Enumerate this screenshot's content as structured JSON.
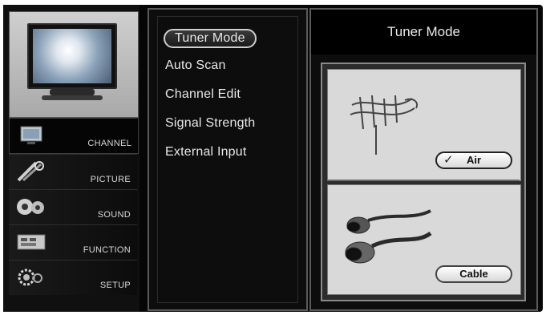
{
  "categories": [
    {
      "label": "CHANNEL",
      "icon": "channel-icon",
      "active": true
    },
    {
      "label": "PICTURE",
      "icon": "picture-icon",
      "active": false
    },
    {
      "label": "SOUND",
      "icon": "sound-icon",
      "active": false
    },
    {
      "label": "FUNCTION",
      "icon": "function-icon",
      "active": false
    },
    {
      "label": "SETUP",
      "icon": "setup-icon",
      "active": false
    }
  ],
  "menu": {
    "items": [
      "Tuner Mode",
      "Auto Scan",
      "Channel Edit",
      "Signal Strength",
      "External Input"
    ],
    "selected": "Tuner Mode"
  },
  "panel": {
    "title": "Tuner Mode",
    "options": [
      {
        "label": "Air",
        "icon": "antenna-icon",
        "selected": true
      },
      {
        "label": "Cable",
        "icon": "cable-connector-icon",
        "selected": false
      }
    ]
  },
  "colors": {
    "background": "#060606",
    "panel_border": "#5a5a5a",
    "text": "#e8e8e8",
    "option_background": "#d9d9d9"
  }
}
